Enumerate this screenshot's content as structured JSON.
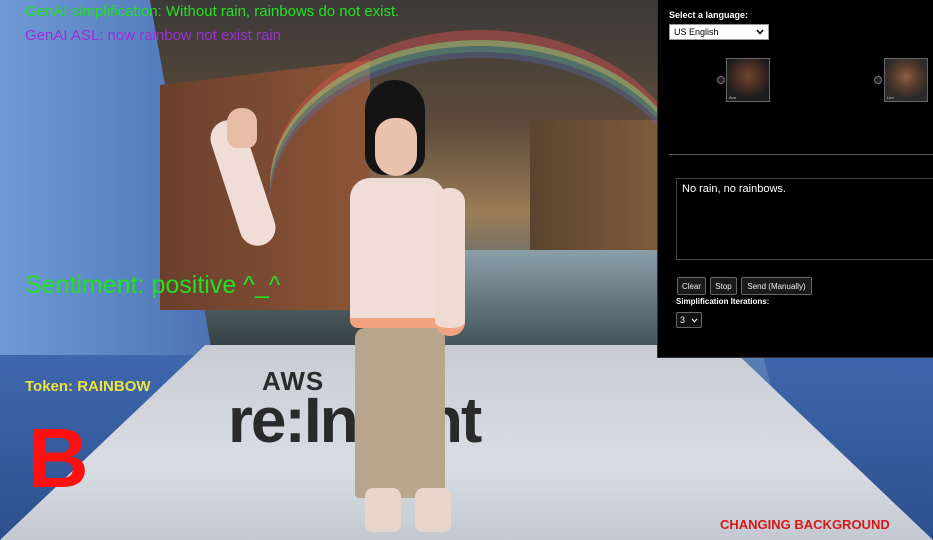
{
  "overlay": {
    "genai_simplification": "GenAI simplification:  Without rain, rainbows do not exist.",
    "genai_asl": "GenAI ASL: now rainbow not exist rain",
    "sentiment": "Sentiment: positive ^_^",
    "token": "Token: RAINBOW",
    "letter": "B",
    "changing_background": "CHANGING BACKGROUND"
  },
  "scene": {
    "logo_aws": "AWS",
    "logo_reinvent": "re:Invent"
  },
  "panel": {
    "language_label": "Select a language:",
    "language_selected": "US English",
    "avatars": [
      {
        "tag": "Ava"
      },
      {
        "tag": "Leo"
      }
    ],
    "input_text": "No rain, no rainbows.",
    "buttons": {
      "clear": "Clear",
      "stop": "Stop",
      "send": "Send (Manually)"
    },
    "iterations_label": "Simplification Iterations:",
    "iterations_value": "3"
  },
  "icons": {
    "dropdown": "chevron-down-icon"
  },
  "colors": {
    "green_text": "#22e022",
    "purple_text": "#9b2fd6",
    "yellow_text": "#f0e23a",
    "red_text": "#ff1010",
    "panel_bg": "#000000"
  }
}
